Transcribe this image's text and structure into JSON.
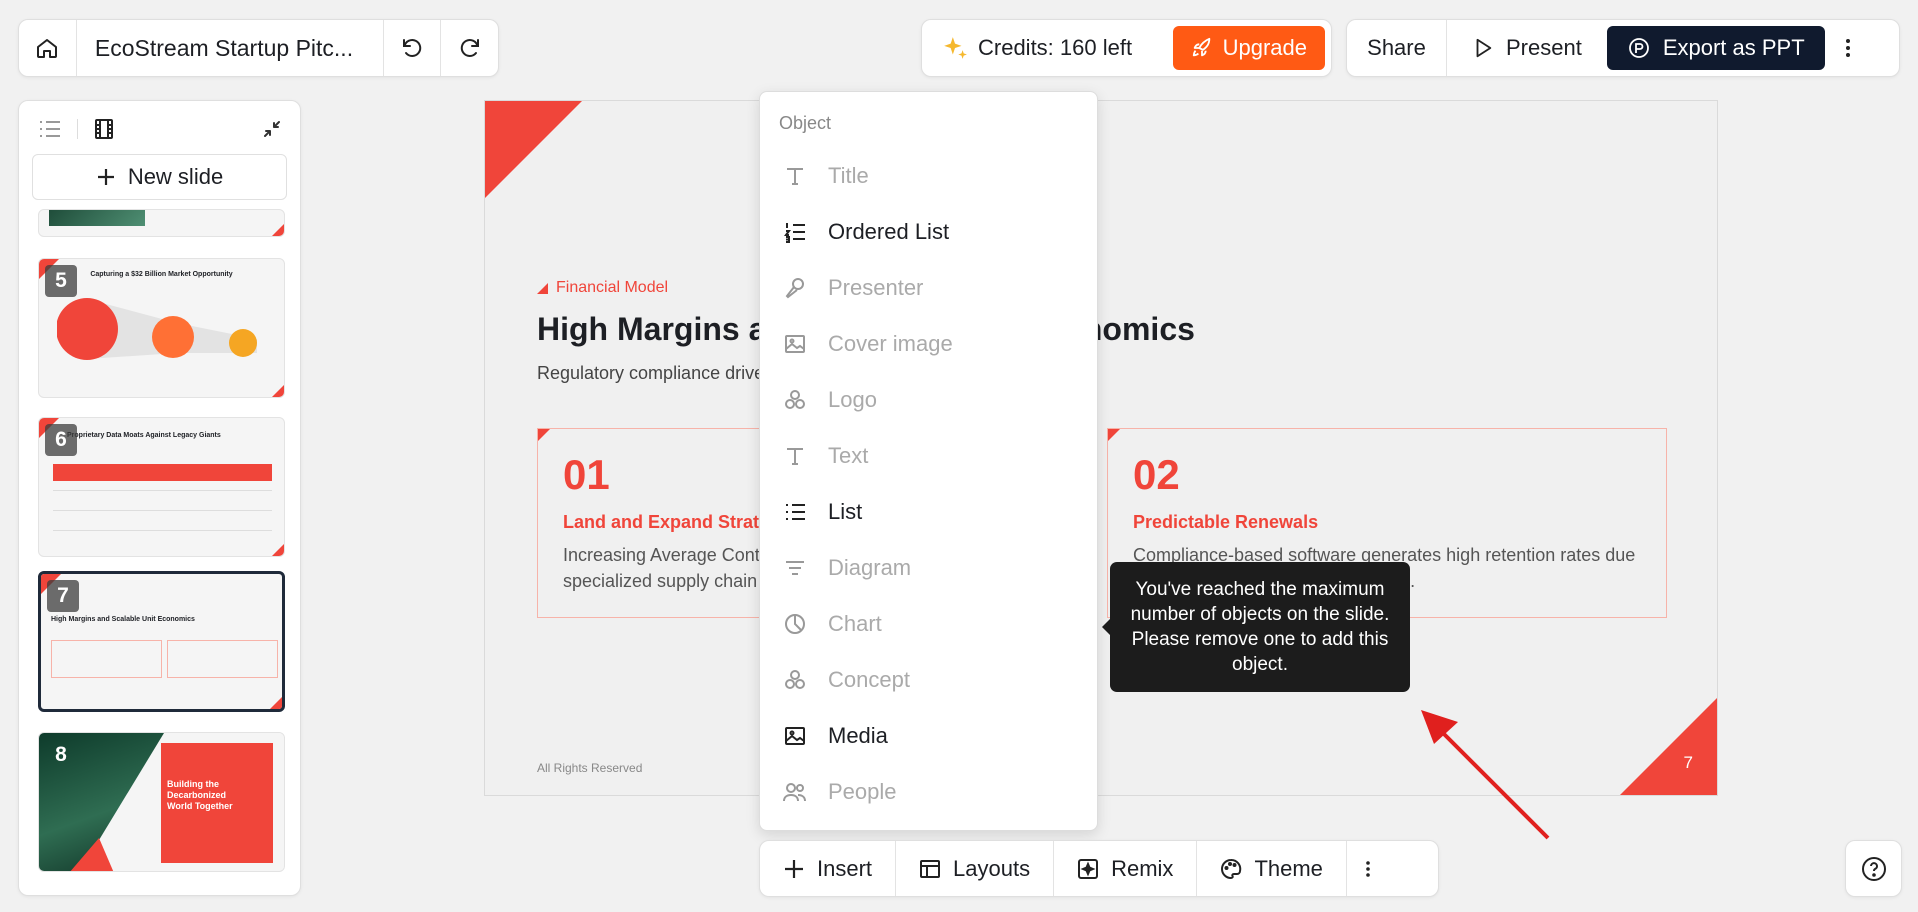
{
  "header": {
    "doc_title": "EcoStream Startup Pitc...",
    "credits_label": "Credits: 160 left",
    "upgrade_label": "Upgrade",
    "share_label": "Share",
    "present_label": "Present",
    "export_label": "Export as PPT"
  },
  "sidebar": {
    "new_slide_label": "New slide",
    "thumbs": [
      {
        "number": "5",
        "title": "Capturing a $32 Billion Market Opportunity"
      },
      {
        "number": "6",
        "title": "Proprietary Data Moats Against Legacy Giants"
      },
      {
        "number": "7",
        "title": "High Margins and Scalable Unit Economics"
      },
      {
        "number": "8",
        "title": "Building the Decarbonized World Together"
      }
    ]
  },
  "slide": {
    "kicker": "Financial Model",
    "title": "High Margins and Scalable Unit Economics",
    "subtitle": "Regulatory compliance drives predictable recurring revenue growth",
    "cards": [
      {
        "num": "01",
        "title": "Land and Expand Strategy",
        "desc": "Increasing Average Contract Value (ACV) through the addition of specialized supply chain modules."
      },
      {
        "num": "02",
        "title": "Predictable Renewals",
        "desc": "Compliance-based software generates high retention rates due to recurring reporting requirements."
      }
    ],
    "footer": "All Rights Reserved",
    "page_number": "7"
  },
  "insert_menu": {
    "heading": "Object",
    "items": [
      {
        "label": "Title",
        "enabled": false,
        "icon": "text-t-icon"
      },
      {
        "label": "Ordered List",
        "enabled": true,
        "icon": "ordered-list-icon"
      },
      {
        "label": "Presenter",
        "enabled": false,
        "icon": "microphone-icon"
      },
      {
        "label": "Cover image",
        "enabled": false,
        "icon": "image-icon"
      },
      {
        "label": "Logo",
        "enabled": false,
        "icon": "shapes-icon"
      },
      {
        "label": "Text",
        "enabled": false,
        "icon": "text-t-icon"
      },
      {
        "label": "List",
        "enabled": true,
        "icon": "bullet-list-icon"
      },
      {
        "label": "Diagram",
        "enabled": false,
        "icon": "diagram-icon"
      },
      {
        "label": "Chart",
        "enabled": false,
        "icon": "pie-chart-icon"
      },
      {
        "label": "Concept",
        "enabled": false,
        "icon": "shapes-icon"
      },
      {
        "label": "Media",
        "enabled": true,
        "icon": "image-icon"
      },
      {
        "label": "People",
        "enabled": false,
        "icon": "people-icon"
      }
    ]
  },
  "tooltip": {
    "text": "You've reached the maximum number of objects on the slide. Please remove one to add this object."
  },
  "toolbar": {
    "insert_label": "Insert",
    "layouts_label": "Layouts",
    "remix_label": "Remix",
    "theme_label": "Theme"
  },
  "colors": {
    "accent": "#f0453a",
    "upgrade": "#ff5a14",
    "export": "#101a2e",
    "annotation_arrow": "#e0201e"
  }
}
